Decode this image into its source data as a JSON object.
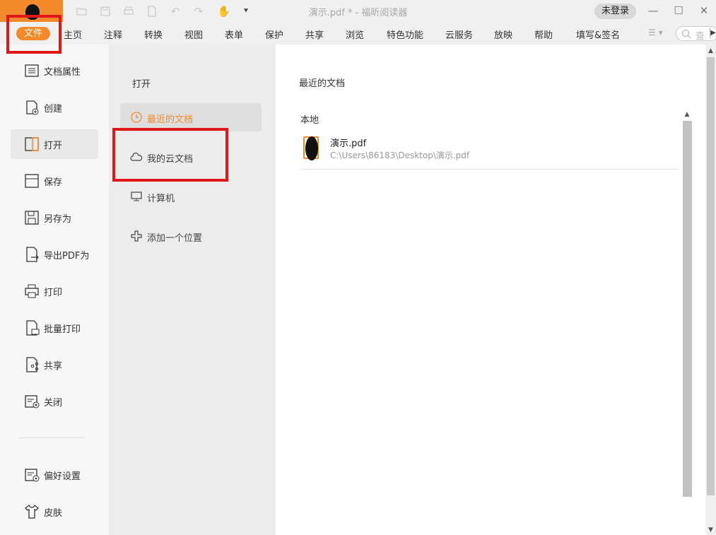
{
  "window": {
    "title": "演示.pdf * - 福昕阅读器",
    "login_label": "未登录",
    "minimize": "—",
    "maximize": "☐",
    "close": "✕"
  },
  "menu": {
    "file": "文件",
    "items": [
      "主页",
      "注释",
      "转换",
      "视图",
      "表单",
      "保护",
      "共享",
      "浏览",
      "特色功能",
      "云服务",
      "放映",
      "帮助",
      "填写&签名"
    ],
    "search_placeholder": "查"
  },
  "leftnav": {
    "items": [
      {
        "label": "文档属性",
        "icon": "document-properties-icon"
      },
      {
        "label": "创建",
        "icon": "create-icon"
      },
      {
        "label": "打开",
        "icon": "open-icon",
        "active": true
      },
      {
        "label": "保存",
        "icon": "save-icon"
      },
      {
        "label": "另存为",
        "icon": "save-as-icon"
      },
      {
        "label": "导出PDF为",
        "icon": "export-icon"
      },
      {
        "label": "打印",
        "icon": "print-icon"
      },
      {
        "label": "批量打印",
        "icon": "batch-print-icon"
      },
      {
        "label": "共享",
        "icon": "share-icon"
      },
      {
        "label": "关闭",
        "icon": "close-doc-icon"
      }
    ],
    "bottom_items": [
      {
        "label": "偏好设置",
        "icon": "preferences-icon"
      },
      {
        "label": "皮肤",
        "icon": "skin-icon"
      }
    ]
  },
  "open_panel": {
    "heading": "打开",
    "items": [
      {
        "label": "最近的文档",
        "icon": "clock-icon",
        "active": true
      },
      {
        "label": "我的云文档",
        "icon": "cloud-icon"
      },
      {
        "label": "计算机",
        "icon": "computer-icon"
      },
      {
        "label": "添加一个位置",
        "icon": "add-location-icon"
      }
    ]
  },
  "recent": {
    "title": "最近的文档",
    "section": "本地",
    "documents": [
      {
        "name": "演示.pdf",
        "path": "C:\\Users\\86183\\Desktop\\演示.pdf"
      }
    ]
  },
  "colors": {
    "accent": "#f28a2c",
    "highlight": "#e01818"
  }
}
